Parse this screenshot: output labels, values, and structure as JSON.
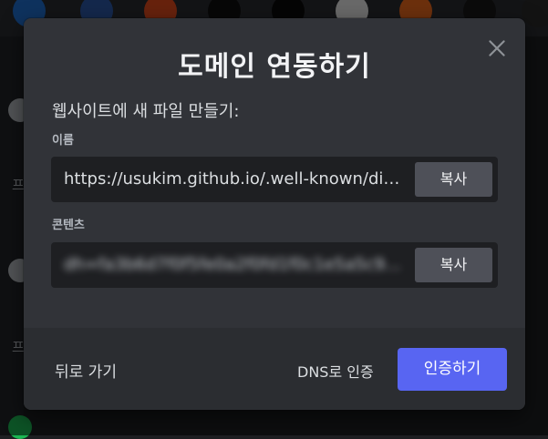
{
  "modal": {
    "title": "도메인 연동하기",
    "subtitle": "웹사이트에 새 파일 만들기:",
    "name_field": {
      "label": "이름",
      "value": "https://usukim.github.io/.well-known/discord",
      "copy_label": "복사"
    },
    "content_field": {
      "label": "콘텐츠",
      "value": "dh=fa3b6d7f0f5fe0a2f0fd1f0c1e5a5c9a1c3e",
      "copy_label": "복사"
    },
    "footer": {
      "back_label": "뒤로 가기",
      "dns_label": "DNS로 인증",
      "verify_label": "인증하기"
    }
  },
  "background": {
    "sidebar_chars": [
      "프",
      "프"
    ]
  },
  "colors": {
    "modal_bg": "#313338",
    "footer_bg": "#2b2d31",
    "primary": "#5865f2",
    "copy_button": "#4e5058"
  },
  "icons": [
    "close-icon",
    "copy",
    "blurred-content"
  ]
}
